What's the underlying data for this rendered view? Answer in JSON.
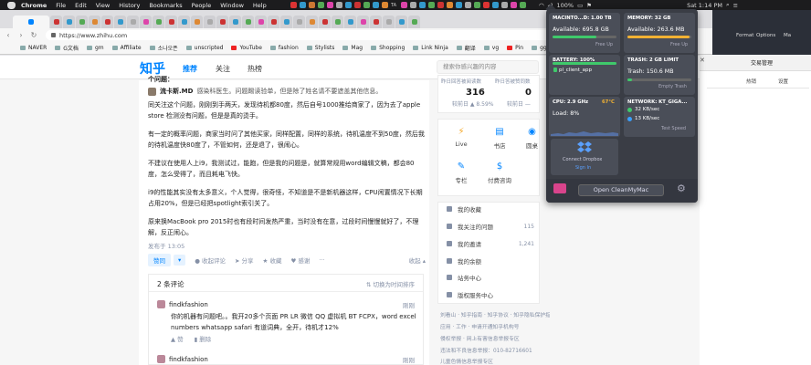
{
  "menubar": {
    "app": "Chrome",
    "items": [
      "File",
      "Edit",
      "View",
      "History",
      "Bookmarks",
      "People",
      "Window",
      "Help"
    ],
    "right": {
      "battery": "100%",
      "datetime": "Sat 1:14 PM"
    },
    "tray_labels": [
      "TA"
    ]
  },
  "browser": {
    "url": "https://www.zhihu.com",
    "bookmarks": [
      "NAVER",
      "G文档",
      "gm",
      "Affiliate",
      "소나오픈",
      "unscripted",
      "YouTube",
      "fashion",
      "Stylists",
      "Mag",
      "Shopping",
      "Link Ninja",
      "翻译",
      "vg",
      "Pin",
      "gg : ios"
    ]
  },
  "zhihu": {
    "logo": "知乎",
    "nav": {
      "home": "推荐",
      "follow": "关注",
      "hot": "热榜"
    },
    "search_placeholder": "搜索你感兴趣的内容",
    "cut_title": "个问题：",
    "author": {
      "name": "流卡斯.MD",
      "bio": "感染科医生。问题踢读验单，但是除了姓名请不要遮盖其他信息。"
    },
    "paragraphs": [
      "同关注这个问题，刚刚到手两天，发现待机都80度，然后自号1000推给商家了，因为去了apple store 检测没有问题，但是是真的烫手。",
      "有一定的概率问题，商家当时问了其他买家，同样配置，同样的系统，待机温度不到50度，然后我的待机温度快80度了，不管如何，还是退了，很闹心。",
      "不建议在使用人上i9，我测试过，能跑，但是我的问题是，就算常规用word编辑文稿，都会80度，怎么受得了，而且耗电飞快。",
      "i9的性能其实没有太多意义，个人觉得，很奇怪，不知道是不是新机器这样，CPU闲置情况下长期占用20%，但是已经把spotlight索引关了。",
      "原来换MacBook pro 2015时也有段时间发热严重，当时没有在意，过段时间慢慢就好了，不理解，反正闹心。"
    ],
    "published": "发布于 13:05",
    "actions": {
      "upvote": "赞同",
      "down": "▾",
      "comment": "收起评论",
      "share": "分享",
      "favorite": "收藏",
      "thanks": "感谢",
      "more": "···",
      "collapse": "收起 ▴"
    },
    "comments": {
      "header": "2 条评论",
      "sort": "⇅ 切换为时间排序",
      "items": [
        {
          "user": "findkfashion",
          "time": "刚刚",
          "text": "你的机器有问题吧。。我开20多个页面 PR LR 微信 QQ 虚拟机 BT FCPX，word excel numbers whatsapp safari 有道词典，全开，待机才12%",
          "like": "赞",
          "delete": "删除"
        },
        {
          "user": "findkfashion",
          "time": "刚刚"
        }
      ]
    },
    "stats": [
      {
        "label": "昨日回答被阅读数",
        "value": "316",
        "sub": "较前日 ▲ 8.59%"
      },
      {
        "label": "昨日答被赞同数",
        "value": "0",
        "sub": "较前日 —"
      }
    ],
    "entries": [
      {
        "icon": "⚡",
        "label": "Live",
        "color": "#f5a623"
      },
      {
        "icon": "▤",
        "label": "书店",
        "color": "#0084ff"
      },
      {
        "icon": "◉",
        "label": "圆桌",
        "color": "#0084ff"
      },
      {
        "icon": "✎",
        "label": "专栏",
        "color": "#0084ff"
      },
      {
        "icon": "$",
        "label": "付费咨询",
        "color": "#0084ff"
      }
    ],
    "list": [
      {
        "label": "我的收藏",
        "count": ""
      },
      {
        "label": "我关注的问题",
        "count": "115"
      },
      {
        "label": "我的邀请",
        "count": "1,241"
      },
      {
        "label": "我的余额",
        "count": ""
      },
      {
        "label": "站务中心",
        "count": ""
      },
      {
        "label": "版权服务中心",
        "count": ""
      }
    ],
    "footer": [
      "刘看山 · 知乎指南 · 知乎协议 · 知乎隐私保护指引",
      "应用 · 工作 · 申请开通知乎机构号",
      "侵权举报 · 网上有害信息举报专区",
      "违法和不良信息举报：010-82716601",
      "儿童色情信息举报专区"
    ]
  },
  "right_window": {
    "title": "交易管理",
    "header_items": [
      "Format",
      "Options",
      "Ma"
    ],
    "cols": [
      "热销",
      "设置"
    ]
  },
  "cleanmymac": {
    "tiles": [
      {
        "title": "MACINTO...D: 1.00 TB",
        "value": "Available: 695.8 GB",
        "sub": "Free Up",
        "bar": 0.68,
        "bar_color": "#3fc96b"
      },
      {
        "title": "MEMORY: 32 GB",
        "value": "Available: 263.6 MB",
        "sub": "Free Up",
        "bar": 0.97,
        "bar_color": "#f2b233"
      },
      {
        "title": "BATTERY: 100%",
        "value": "pl_client_app",
        "sub": "",
        "bar": 1.0,
        "bar_color": "#3fc96b"
      },
      {
        "title": "TRASH: 2 GB LIMIT",
        "value": "Trash: 150.6 MB",
        "sub": "Empty Trash",
        "bar": 0.07,
        "bar_color": "#3fc96b"
      },
      {
        "title": "CPU: 2.9 GHz",
        "temp": "67°C",
        "value": "Load: 8%",
        "sub": ""
      },
      {
        "title": "NETWORK: KT_GIGA...",
        "up": "32 KB/sec",
        "down": "13 KB/sec",
        "sub": "Test Speed"
      }
    ],
    "dropbox": {
      "label": "Connect Dropbox",
      "action": "Sign In"
    },
    "open_button": "Open CleanMyMac"
  }
}
